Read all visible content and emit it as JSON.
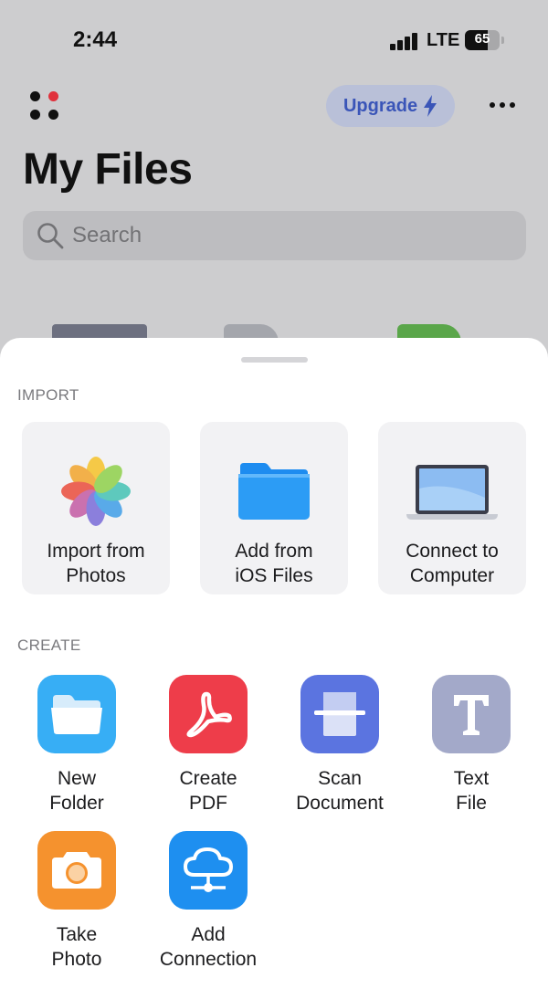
{
  "status_bar": {
    "time": "2:44",
    "network": "LTE",
    "battery": "65",
    "battery_level": 0.65
  },
  "header": {
    "upgrade_label": "Upgrade",
    "title": "My Files"
  },
  "search": {
    "placeholder": "Search"
  },
  "sheet": {
    "import_header": "IMPORT",
    "import_items": [
      {
        "line1": "Import from",
        "line2": "Photos",
        "icon": "photos-icon"
      },
      {
        "line1": "Add from",
        "line2": "iOS Files",
        "icon": "ios-files-folder-icon"
      },
      {
        "line1": "Connect to",
        "line2": "Computer",
        "icon": "laptop-icon"
      }
    ],
    "create_header": "CREATE",
    "create_items": [
      {
        "line1": "New",
        "line2": "Folder",
        "icon": "folder-icon",
        "color": "#37aef5"
      },
      {
        "line1": "Create",
        "line2": "PDF",
        "icon": "pdf-icon",
        "color": "#ee3d4a"
      },
      {
        "line1": "Scan",
        "line2": "Document",
        "icon": "scan-icon",
        "color": "#5b74e0"
      },
      {
        "line1": "Text",
        "line2": "File",
        "icon": "text-icon",
        "color": "#a3a9c9"
      },
      {
        "line1": "Take",
        "line2": "Photo",
        "icon": "camera-icon",
        "color": "#f5922e"
      },
      {
        "line1": "Add",
        "line2": "Connection",
        "icon": "cloud-network-icon",
        "color": "#1e8ff0"
      }
    ]
  },
  "colors": {
    "accent": "#3a55b8",
    "logo_red": "#e0313c"
  }
}
